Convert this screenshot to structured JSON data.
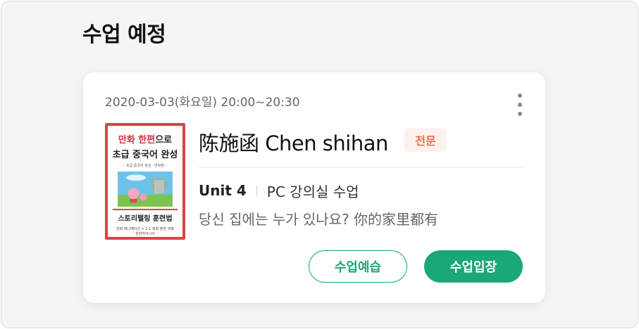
{
  "section": {
    "title": "수업 예정"
  },
  "lesson": {
    "datetime": "2020-03-03(화요일) 20:00~20:30",
    "teacher_name": "陈施函 Chen shihan",
    "teacher_badge": "전문",
    "unit": "Unit 4",
    "room": "PC 강의실 수업",
    "title": "당신 집에는 누가 있나요? 你的家里都有",
    "buttons": {
      "preview": "수업예습",
      "enter": "수업입장"
    }
  },
  "book": {
    "title_red": "만화 한편",
    "title_rest": "으로",
    "title_line2": "초급 중국어 완성",
    "subtitle": "- 초급 중국어 완성 · 만화편 -",
    "story": "스토리텔링 훈련법",
    "footer_line1": "만화 애니메이션 + 1:1 회화 훈련 과정",
    "footer_line2": "한한차이나즈"
  },
  "colors": {
    "accent": "#1aa874",
    "badge_text": "#e8704f",
    "book_border": "#d64545"
  },
  "icons": {
    "menu": "more-vertical-icon"
  }
}
